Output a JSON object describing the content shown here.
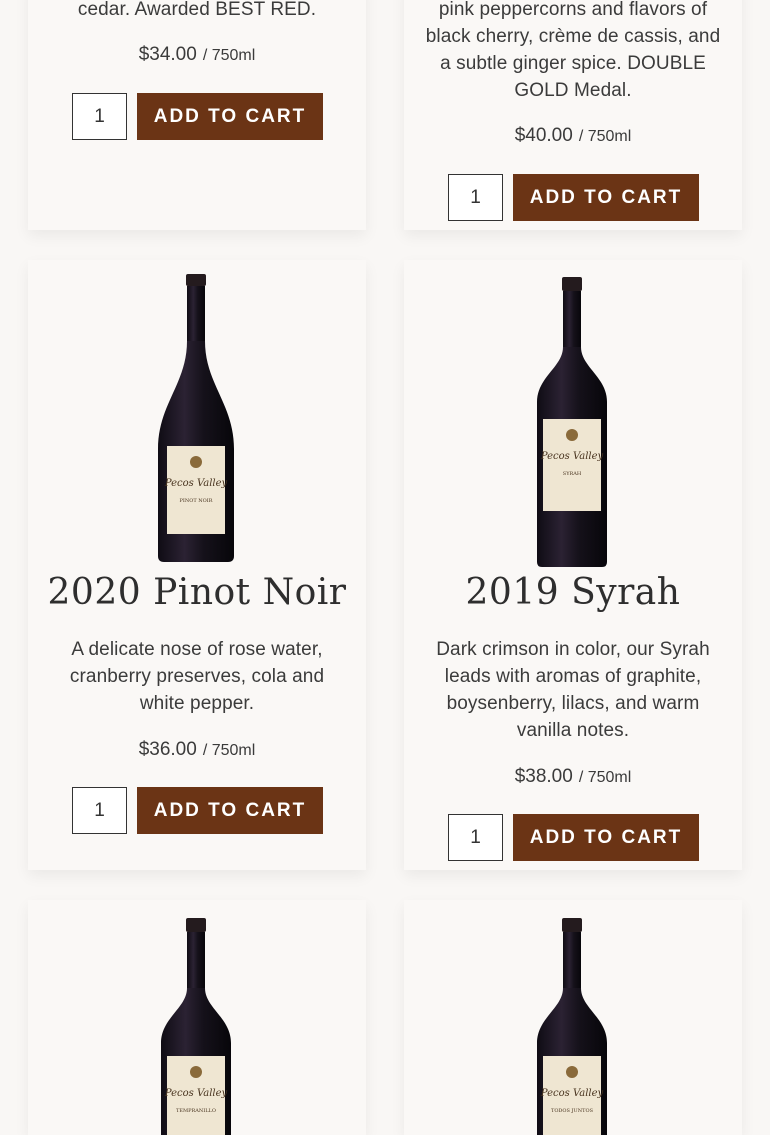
{
  "products": [
    {
      "desc_lines": [
        "cedar. Awarded BEST RED."
      ],
      "price": "$34.00",
      "unit": "/ 750ml",
      "qty": "1",
      "cart_label": "ADD TO CART"
    },
    {
      "desc_lines": [
        "pink peppercorns and flavors of",
        "black cherry, crème de cassis, and",
        "a subtle ginger spice. DOUBLE",
        "GOLD Medal."
      ],
      "price": "$40.00",
      "unit": "/ 750ml",
      "qty": "1",
      "cart_label": "ADD TO CART"
    },
    {
      "name": "2020 Pinot Noir",
      "label_brand": "Pecos Valley",
      "label_varietal": "PINOT NOIR",
      "desc_lines": [
        "A delicate nose of rose water,",
        "cranberry preserves, cola and",
        "white pepper."
      ],
      "price": "$36.00",
      "unit": "/ 750ml",
      "qty": "1",
      "cart_label": "ADD TO CART"
    },
    {
      "name": "2019 Syrah",
      "label_brand": "Pecos Valley",
      "label_varietal": "SYRAH",
      "desc_lines": [
        "Dark crimson in color, our Syrah",
        "leads with aromas of graphite,",
        "boysenberry, lilacs, and warm",
        "vanilla notes."
      ],
      "price": "$38.00",
      "unit": "/ 750ml",
      "qty": "1",
      "cart_label": "ADD TO CART"
    },
    {
      "label_brand": "Pecos Valley",
      "label_varietal": "TEMPRANILLO"
    },
    {
      "label_brand": "Pecos Valley",
      "label_varietal": "TODOS JUNTOS"
    }
  ],
  "colors": {
    "button": "#6b3415",
    "bottle": "#1f1a22",
    "label": "#efe6d2"
  }
}
